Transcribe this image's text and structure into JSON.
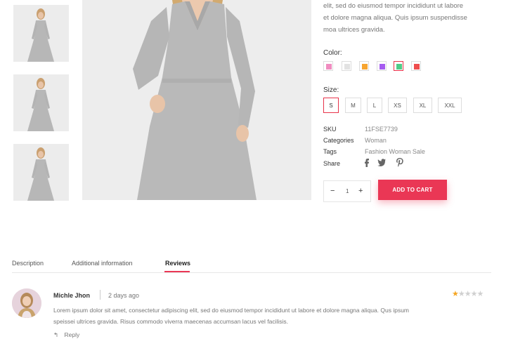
{
  "product": {
    "description_lines": [
      "elit, sed do eiusmod tempor incididunt ut labore",
      "et dolore magna aliqua. Quis ipsum suspendisse",
      "moa ultrices gravida."
    ],
    "color_label": "Color:",
    "colors": [
      {
        "hex": "#f08cc0",
        "selected": false
      },
      {
        "hex": "#e2e2e2",
        "selected": false
      },
      {
        "hex": "#f7a530",
        "selected": false
      },
      {
        "hex": "#a65cf0",
        "selected": false
      },
      {
        "hex": "#4fcc88",
        "selected": true
      },
      {
        "hex": "#ef4d4d",
        "selected": false
      }
    ],
    "size_label": "Size:",
    "sizes": [
      {
        "label": "S",
        "selected": true
      },
      {
        "label": "M",
        "selected": false
      },
      {
        "label": "L",
        "selected": false
      },
      {
        "label": "XS",
        "selected": false
      },
      {
        "label": "XL",
        "selected": false
      },
      {
        "label": "XXL",
        "selected": false
      }
    ],
    "meta": {
      "sku_key": "SKU",
      "sku_value": "11FSE7739",
      "categories_key": "Categories",
      "categories_value": "Woman",
      "tags_key": "Tags",
      "tags_value": "Fashion Woman Sale",
      "share_key": "Share",
      "share_icons": [
        "facebook-icon",
        "twitter-icon",
        "pinterest-icon"
      ]
    },
    "quantity": {
      "minus": "−",
      "value": "1",
      "plus": "+"
    },
    "add_to_cart": "ADD TO CART"
  },
  "tabs": [
    {
      "label": "Description",
      "active": false
    },
    {
      "label": "Additional information",
      "active": false
    },
    {
      "label": "Reviews",
      "active": true
    }
  ],
  "review": {
    "name": "Michle Jhon",
    "date": "2 days ago",
    "rating": 1,
    "max_rating": 5,
    "text_lines": [
      "Lorem ipsum dolor sit amet, consectetur adipiscing elit, sed do eiusmod tempor incididunt ut labore et dolore magna aliqua. Qus ipsum",
      "speissei ultrices gravida. Risus commodo viverra maecenas accumsan lacus vel facilisis."
    ],
    "reply_label": "Reply"
  },
  "colors": {
    "accent": "#ea3755",
    "star_filled": "#f5a623",
    "star_empty": "#d0d0d0"
  }
}
